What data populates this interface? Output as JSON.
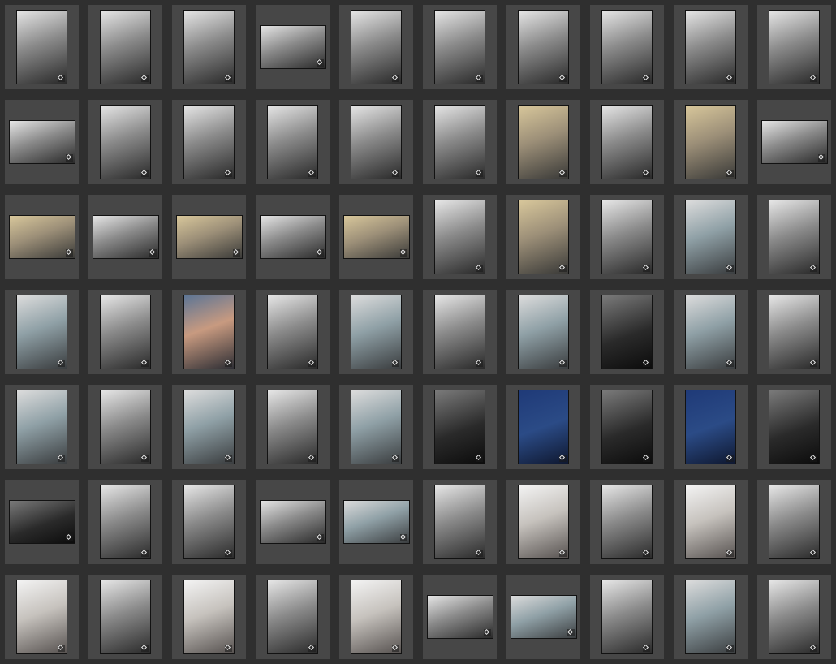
{
  "grid": {
    "columns": 10,
    "rows": 7,
    "colors": {
      "background": "#2f2f2f",
      "cell": "#474747",
      "thumb_border": "#121212",
      "badge_icon": "#e6e6e6"
    },
    "badge_icon": "edited-badge-icon",
    "thumbnails": [
      {
        "orientation": "portrait",
        "tone": "bw"
      },
      {
        "orientation": "portrait",
        "tone": "bw"
      },
      {
        "orientation": "portrait",
        "tone": "bw"
      },
      {
        "orientation": "landscape",
        "tone": "bw"
      },
      {
        "orientation": "portrait",
        "tone": "bw"
      },
      {
        "orientation": "portrait",
        "tone": "bw"
      },
      {
        "orientation": "portrait",
        "tone": "bw"
      },
      {
        "orientation": "portrait",
        "tone": "bw"
      },
      {
        "orientation": "portrait",
        "tone": "bw"
      },
      {
        "orientation": "portrait",
        "tone": "bw"
      },
      {
        "orientation": "landscape",
        "tone": "bw"
      },
      {
        "orientation": "portrait",
        "tone": "bw"
      },
      {
        "orientation": "portrait",
        "tone": "bw"
      },
      {
        "orientation": "portrait",
        "tone": "bw"
      },
      {
        "orientation": "portrait",
        "tone": "bw"
      },
      {
        "orientation": "portrait",
        "tone": "bw"
      },
      {
        "orientation": "portrait",
        "tone": "color-beige"
      },
      {
        "orientation": "portrait",
        "tone": "bw"
      },
      {
        "orientation": "portrait",
        "tone": "color-beige"
      },
      {
        "orientation": "landscape",
        "tone": "bw"
      },
      {
        "orientation": "landscape",
        "tone": "color-beige"
      },
      {
        "orientation": "landscape",
        "tone": "bw"
      },
      {
        "orientation": "landscape",
        "tone": "color-beige"
      },
      {
        "orientation": "landscape",
        "tone": "bw"
      },
      {
        "orientation": "landscape",
        "tone": "color-beige"
      },
      {
        "orientation": "portrait",
        "tone": "bw"
      },
      {
        "orientation": "portrait",
        "tone": "color-beige"
      },
      {
        "orientation": "portrait",
        "tone": "bw"
      },
      {
        "orientation": "portrait",
        "tone": "color-gray"
      },
      {
        "orientation": "portrait",
        "tone": "bw"
      },
      {
        "orientation": "portrait",
        "tone": "color-gray"
      },
      {
        "orientation": "portrait",
        "tone": "bw"
      },
      {
        "orientation": "portrait",
        "tone": "color-blue"
      },
      {
        "orientation": "portrait",
        "tone": "bw"
      },
      {
        "orientation": "portrait",
        "tone": "color-gray"
      },
      {
        "orientation": "portrait",
        "tone": "bw"
      },
      {
        "orientation": "portrait",
        "tone": "color-gray"
      },
      {
        "orientation": "portrait",
        "tone": "bw-dark"
      },
      {
        "orientation": "portrait",
        "tone": "color-gray"
      },
      {
        "orientation": "portrait",
        "tone": "bw"
      },
      {
        "orientation": "portrait",
        "tone": "color-gray"
      },
      {
        "orientation": "portrait",
        "tone": "bw"
      },
      {
        "orientation": "portrait",
        "tone": "color-gray"
      },
      {
        "orientation": "portrait",
        "tone": "bw"
      },
      {
        "orientation": "portrait",
        "tone": "color-gray"
      },
      {
        "orientation": "portrait",
        "tone": "bw-dark"
      },
      {
        "orientation": "portrait",
        "tone": "color-navy"
      },
      {
        "orientation": "portrait",
        "tone": "bw-dark"
      },
      {
        "orientation": "portrait",
        "tone": "color-navy"
      },
      {
        "orientation": "portrait",
        "tone": "bw-dark"
      },
      {
        "orientation": "landscape",
        "tone": "bw-dark"
      },
      {
        "orientation": "portrait",
        "tone": "bw"
      },
      {
        "orientation": "portrait",
        "tone": "bw"
      },
      {
        "orientation": "landscape",
        "tone": "bw"
      },
      {
        "orientation": "landscape",
        "tone": "color-gray"
      },
      {
        "orientation": "portrait",
        "tone": "bw"
      },
      {
        "orientation": "portrait",
        "tone": "color-light"
      },
      {
        "orientation": "portrait",
        "tone": "bw"
      },
      {
        "orientation": "portrait",
        "tone": "color-light"
      },
      {
        "orientation": "portrait",
        "tone": "bw"
      },
      {
        "orientation": "portrait",
        "tone": "color-light"
      },
      {
        "orientation": "portrait",
        "tone": "bw"
      },
      {
        "orientation": "portrait",
        "tone": "color-light"
      },
      {
        "orientation": "portrait",
        "tone": "bw"
      },
      {
        "orientation": "portrait",
        "tone": "color-light"
      },
      {
        "orientation": "landscape",
        "tone": "bw"
      },
      {
        "orientation": "landscape",
        "tone": "color-gray"
      },
      {
        "orientation": "portrait",
        "tone": "bw"
      },
      {
        "orientation": "portrait",
        "tone": "color-gray"
      },
      {
        "orientation": "portrait",
        "tone": "bw"
      }
    ]
  }
}
